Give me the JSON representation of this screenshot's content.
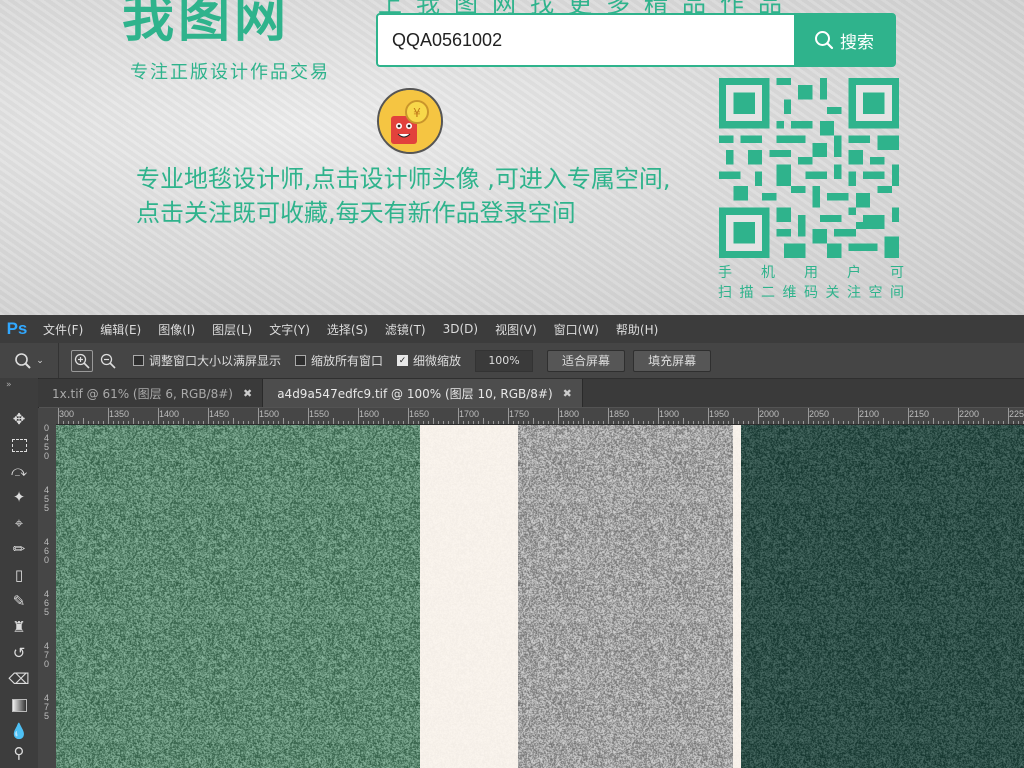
{
  "banner": {
    "logo": "我图网",
    "logo_sub": "专注正版设计作品交易",
    "slogan": "上我图网找更多精品作品",
    "search": {
      "value": "QQA0561002",
      "button_label": "搜索"
    },
    "description": "专业地毯设计师,点击设计师头像 ,可进入专属空间,点击关注既可收藏,每天有新作品登录空间",
    "qr_caption_1": [
      "手",
      "机",
      "用",
      "户",
      "可"
    ],
    "qr_caption_2": [
      "扫",
      "描",
      "二",
      "维",
      "码",
      "关",
      "注",
      "空",
      "间"
    ]
  },
  "photoshop": {
    "app_logo": "Ps",
    "menu": [
      "文件(F)",
      "编辑(E)",
      "图像(I)",
      "图层(L)",
      "文字(Y)",
      "选择(S)",
      "滤镜(T)",
      "3D(D)",
      "视图(V)",
      "窗口(W)",
      "帮助(H)"
    ],
    "options": {
      "resize_windows": {
        "label": "调整窗口大小以满屏显示",
        "checked": false
      },
      "zoom_all": {
        "label": "缩放所有窗口",
        "checked": false
      },
      "scrubby_zoom": {
        "label": "细微缩放",
        "checked": true
      },
      "zoom_value": "100%",
      "fit_screen": "适合屏幕",
      "fill_screen": "填充屏幕"
    },
    "tabs": [
      {
        "label": "1x.tif @ 61% (图层 6, RGB/8#)",
        "active": false
      },
      {
        "label": "a4d9a547edfc9.tif @ 100% (图层 10, RGB/8#)",
        "active": true
      }
    ],
    "ruler_h_labels": [
      "300",
      "1350",
      "1400",
      "1450",
      "1500",
      "1550",
      "1600",
      "1650",
      "1700",
      "1750",
      "1800",
      "1850",
      "1900",
      "1950",
      "2000",
      "2050",
      "2100",
      "2150",
      "2200",
      "2250"
    ],
    "ruler_v_labels": [
      "0",
      "4 5 0",
      "4 5 5",
      "4 6 0",
      "4 6 5",
      "4 7 0",
      "4 7 5"
    ],
    "canvas_colors": [
      "#5e8a72",
      "#f7f1ea",
      "#a3a3a3",
      "#2f5049"
    ],
    "tool_icons": [
      "move-icon",
      "marquee-icon",
      "lasso-icon",
      "magic-wand-icon",
      "crop-icon",
      "eyedropper-icon",
      "healing-icon",
      "brush-icon",
      "stamp-icon",
      "history-brush-icon",
      "eraser-icon",
      "gradient-icon",
      "blur-icon",
      "dodge-icon"
    ]
  }
}
